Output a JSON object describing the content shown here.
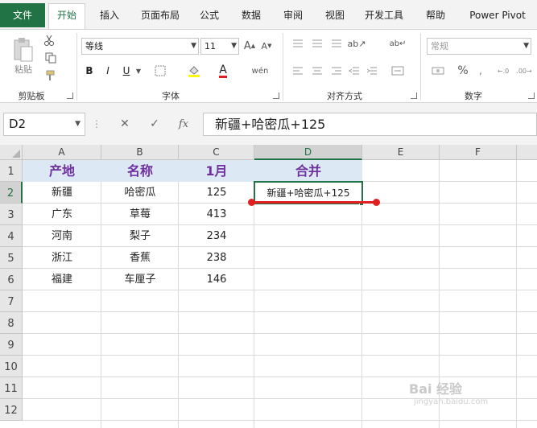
{
  "tabs": [
    {
      "label": "文件",
      "name": "tab-file"
    },
    {
      "label": "开始",
      "name": "tab-home"
    },
    {
      "label": "插入",
      "name": "tab-insert"
    },
    {
      "label": "页面布局",
      "name": "tab-page-layout"
    },
    {
      "label": "公式",
      "name": "tab-formulas"
    },
    {
      "label": "数据",
      "name": "tab-data"
    },
    {
      "label": "审阅",
      "name": "tab-review"
    },
    {
      "label": "视图",
      "name": "tab-view"
    },
    {
      "label": "开发工具",
      "name": "tab-developer"
    },
    {
      "label": "帮助",
      "name": "tab-help"
    },
    {
      "label": "Power Pivot",
      "name": "tab-power-pivot"
    }
  ],
  "ribbon": {
    "clipboard": {
      "label": "剪贴板",
      "paste_label": "粘贴"
    },
    "font": {
      "label": "字体",
      "font_name": "等线",
      "font_size": "11",
      "bold": "B",
      "italic": "I",
      "underline": "U",
      "font_color_glyph": "A"
    },
    "alignment": {
      "label": "对齐方式"
    },
    "number": {
      "label": "数字",
      "format": "常规",
      "percent": "%"
    }
  },
  "formula_bar": {
    "name_box": "D2",
    "cancel": "✕",
    "enter": "✓",
    "fx": "fx",
    "formula": "新疆+哈密瓜+125"
  },
  "columns": [
    "A",
    "B",
    "C",
    "D",
    "E",
    "F"
  ],
  "rows": [
    "1",
    "2",
    "3",
    "4",
    "5",
    "6",
    "7",
    "8",
    "9",
    "10",
    "11",
    "12"
  ],
  "sheet": {
    "headers": [
      "产地",
      "名称",
      "1月",
      "合并"
    ],
    "data": [
      [
        "新疆",
        "哈密瓜",
        "125",
        "新疆+哈密瓜+125"
      ],
      [
        "广东",
        "草莓",
        "413",
        ""
      ],
      [
        "河南",
        "梨子",
        "234",
        ""
      ],
      [
        "浙江",
        "香蕉",
        "238",
        ""
      ],
      [
        "福建",
        "车厘子",
        "146",
        ""
      ]
    ]
  },
  "selected_cell": "D2",
  "colors": {
    "accent": "#217346",
    "header_text": "#7030a0",
    "header_fill": "#dce9f5",
    "annotation": "#e02020"
  },
  "watermark": {
    "text": "Bai 经验",
    "sub": "jingyan.baidu.com"
  }
}
